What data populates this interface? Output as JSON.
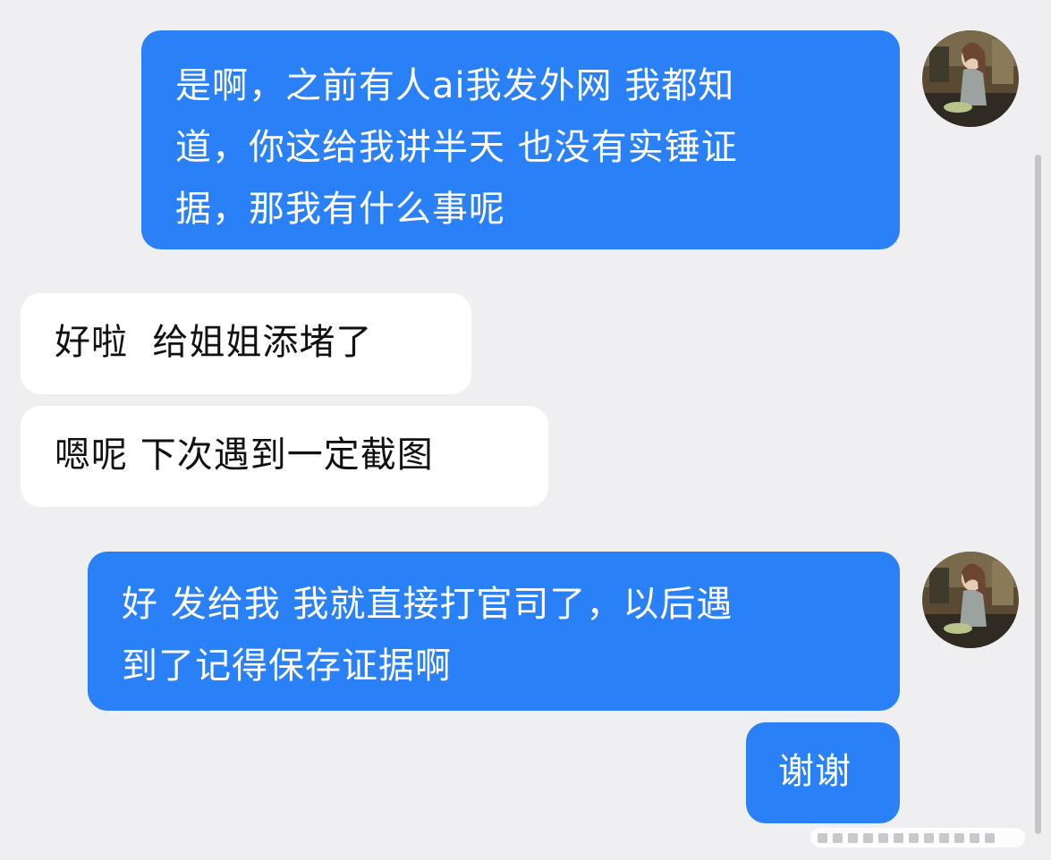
{
  "messages": [
    {
      "side": "outgoing",
      "lines": [
        "是啊，之前有人ai我发外网 我都知",
        "道，你这给我讲半天 也没有实锤证",
        "据，那我有什么事呢"
      ]
    },
    {
      "side": "incoming",
      "lines": [
        "好啦  给姐姐添堵了"
      ]
    },
    {
      "side": "incoming",
      "lines": [
        "嗯呢 下次遇到一定截图"
      ]
    },
    {
      "side": "outgoing",
      "lines": [
        "好 发给我 我就直接打官司了，以后遇",
        "到了记得保存证据啊"
      ]
    },
    {
      "side": "outgoing",
      "lines": [
        "谢谢"
      ]
    }
  ],
  "colors": {
    "background": "#efeff1",
    "outgoing_bubble": "#2a80f7",
    "incoming_bubble": "#ffffff"
  },
  "icons": {
    "avatar": "user-avatar-photo"
  }
}
